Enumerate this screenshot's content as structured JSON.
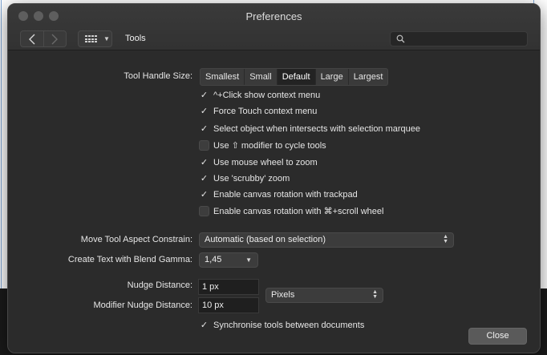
{
  "window": {
    "title": "Preferences"
  },
  "toolbar": {
    "section_title": "Tools",
    "search_placeholder": ""
  },
  "tool_handle_size": {
    "label": "Tool Handle Size:",
    "options": [
      "Smallest",
      "Small",
      "Default",
      "Large",
      "Largest"
    ],
    "selected": "Default"
  },
  "options": [
    {
      "label": "^+Click show context menu",
      "checked": true
    },
    {
      "label": "Force Touch context menu",
      "checked": true
    },
    {
      "label": "Select object when intersects with selection marquee",
      "checked": true
    },
    {
      "label": "Use ⇧ modifier to cycle tools",
      "checked": false
    },
    {
      "label": "Use mouse wheel to zoom",
      "checked": true
    },
    {
      "label": "Use 'scrubby' zoom",
      "checked": true
    },
    {
      "label": "Enable canvas rotation with trackpad",
      "checked": true
    },
    {
      "label": "Enable canvas rotation with ⌘+scroll wheel",
      "checked": false
    }
  ],
  "move_tool": {
    "label": "Move Tool Aspect Constrain:",
    "value": "Automatic (based on selection)"
  },
  "blend_gamma": {
    "label": "Create Text with Blend Gamma:",
    "value": "1,45"
  },
  "nudge": {
    "label": "Nudge Distance:",
    "value": "1 px"
  },
  "modifier_nudge": {
    "label": "Modifier Nudge Distance:",
    "value": "10 px"
  },
  "units": {
    "value": "Pixels"
  },
  "sync": {
    "label": "Synchronise tools between documents",
    "checked": true
  },
  "buttons": {
    "close": "Close"
  },
  "icons": {
    "back": "chevron-left-icon",
    "forward": "chevron-right-icon",
    "grid": "grid-icon",
    "search": "search-icon"
  },
  "colors": {
    "window_bg": "#2b2b2b",
    "titlebar": "#353535",
    "field_bg": "#1f1f1f"
  }
}
